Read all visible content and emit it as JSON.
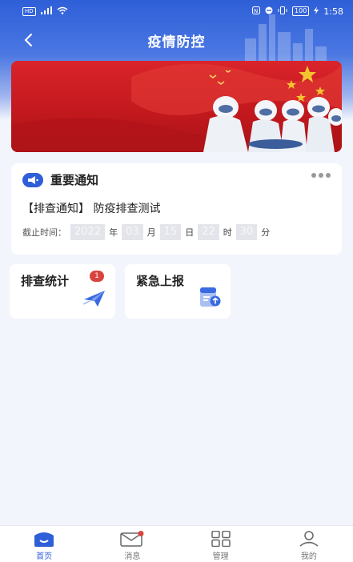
{
  "status_bar": {
    "left_text": "HD",
    "right_battery": "100",
    "time": "1:58"
  },
  "header": {
    "title": "疫情防控"
  },
  "notice": {
    "title": "重要通知",
    "item": "【排查通知】 防疫排查测试",
    "deadline_label": "截止时间：",
    "year": "2022",
    "year_unit": "年",
    "month": "03",
    "month_unit": "月",
    "day": "15",
    "day_unit": "日",
    "hour": "22",
    "hour_unit": "时",
    "minute": "30",
    "minute_unit": "分"
  },
  "actions": [
    {
      "label": "排查统计",
      "badge": "1",
      "icon": "paper-plane-icon"
    },
    {
      "label": "紧急上报",
      "icon": "document-upload-icon"
    }
  ],
  "tabs": [
    {
      "label": "首页",
      "icon": "home-icon",
      "active": true
    },
    {
      "label": "消息",
      "icon": "mail-icon",
      "has_dot": true
    },
    {
      "label": "管理",
      "icon": "grid-icon"
    },
    {
      "label": "我的",
      "icon": "user-icon"
    }
  ],
  "colors": {
    "primary": "#2f5fd8",
    "banner_red": "#c0181d",
    "badge_red": "#d9443c"
  }
}
